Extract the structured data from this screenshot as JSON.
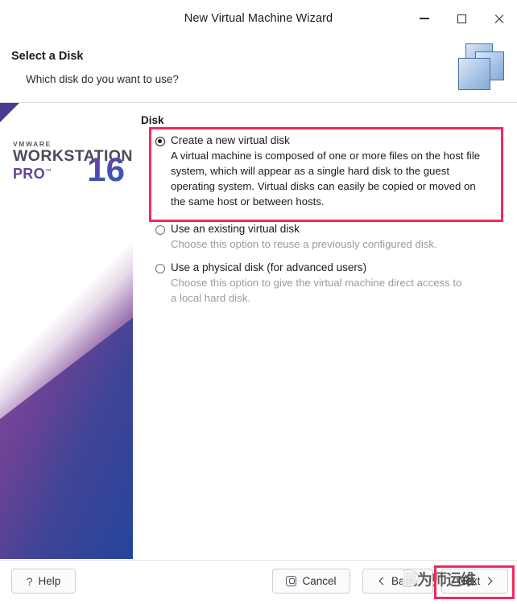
{
  "window": {
    "title": "New Virtual Machine Wizard",
    "controls": {
      "minimize": "minimize-icon",
      "maximize": "maximize-icon",
      "close": "close-icon"
    }
  },
  "header": {
    "title": "Select a Disk",
    "subtitle": "Which disk do you want to use?",
    "artwork": "stacked-disks-icon"
  },
  "sidebar": {
    "vendor": "VMWARE",
    "product": "WORKSTATION",
    "edition": "PRO",
    "trademark": "™",
    "version": "16"
  },
  "main": {
    "group_label": "Disk",
    "options": [
      {
        "label": "Create a new virtual disk",
        "description": "A virtual machine is composed of one or more files on the host file system, which will appear as a single hard disk to the guest operating system. Virtual disks can easily be copied or moved on the same host or between hosts.",
        "selected": true,
        "muted_description": false
      },
      {
        "label": "Use an existing virtual disk",
        "description": "Choose this option to reuse a previously configured disk.",
        "selected": false,
        "muted_description": true
      },
      {
        "label": "Use a physical disk (for advanced users)",
        "description": "Choose this option to give the virtual machine direct access to a local hard disk.",
        "selected": false,
        "muted_description": true
      }
    ]
  },
  "footer": {
    "help_label": "Help",
    "cancel_label": "Cancel",
    "back_label": "Back",
    "next_label": "Next",
    "help_icon": "question-mark-icon",
    "cancel_icon": "cancel-octagon-icon",
    "back_icon": "chevron-left-icon",
    "next_icon": "chevron-right-icon"
  },
  "annotations": {
    "highlight_color": "#f2295b",
    "boxes": [
      "create-new-virtual-disk-option",
      "next-button"
    ]
  },
  "watermark": {
    "text": "鹏为师运维"
  }
}
